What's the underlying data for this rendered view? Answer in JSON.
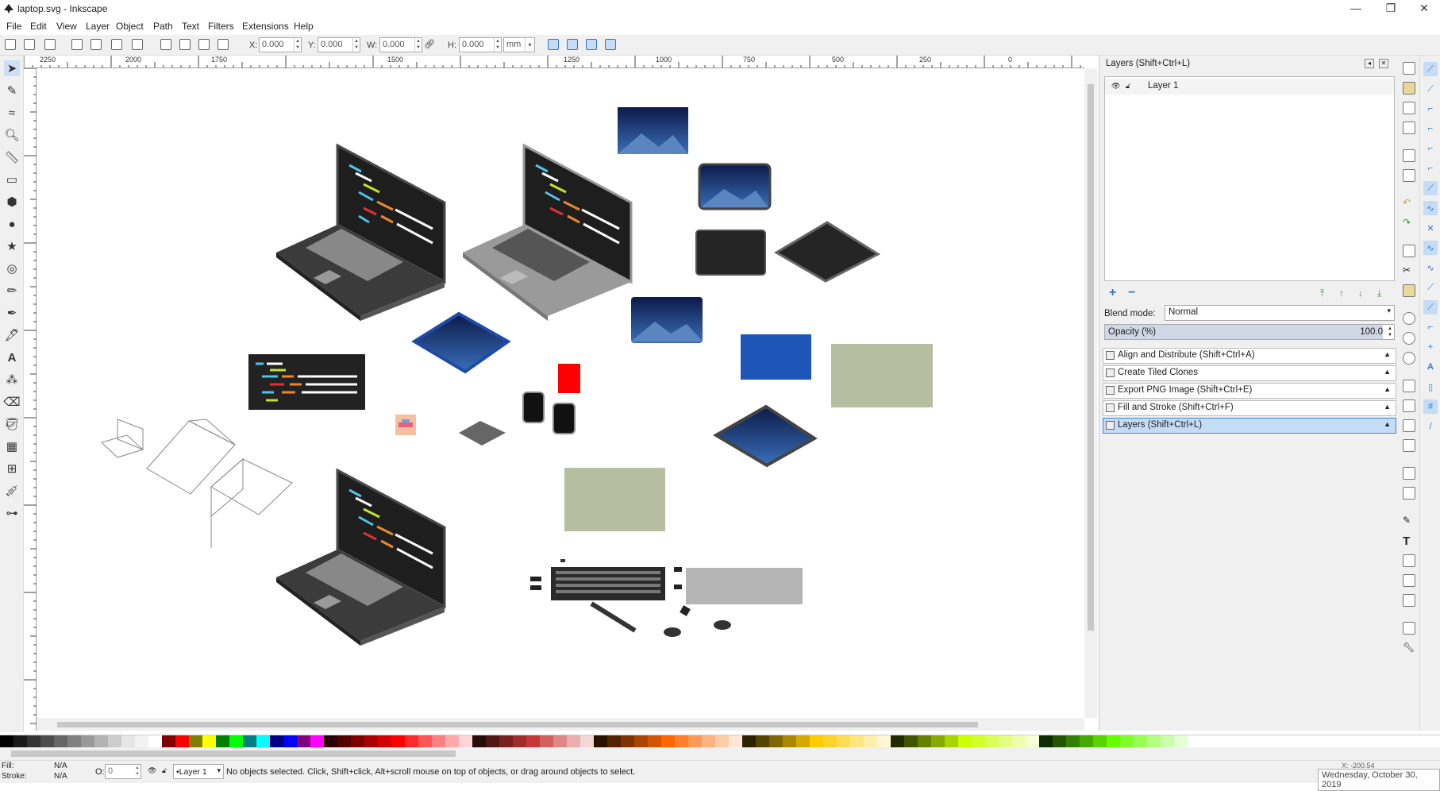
{
  "window": {
    "title": "laptop.svg - Inkscape",
    "minimize": "—",
    "maximize": "❐",
    "close": "✕"
  },
  "menu": [
    "File",
    "Edit",
    "View",
    "Layer",
    "Object",
    "Path",
    "Text",
    "Filters",
    "Extensions",
    "Help"
  ],
  "toolbar": {
    "x_label": "X:",
    "x_value": "0.000",
    "y_label": "Y:",
    "y_value": "0.000",
    "w_label": "W:",
    "w_value": "0.000",
    "h_label": "H:",
    "h_value": "0.000",
    "unit": "mm"
  },
  "ruler": {
    "h_ticks": [
      "2250",
      "2000",
      "1750",
      "1500",
      "1250",
      "1000",
      "750",
      "500",
      "250",
      "0"
    ]
  },
  "panel": {
    "layers_title": "Layers (Shift+Ctrl+L)",
    "layer_name": "Layer 1",
    "blend_label": "Blend mode:",
    "blend_value": "Normal",
    "opacity_label": "Opacity (%)",
    "opacity_value": "100.0",
    "opacity_level": 1.0,
    "docks": [
      "Align and Distribute (Shift+Ctrl+A)",
      "Create Tiled Clones",
      "Export PNG Image (Shift+Ctrl+E)",
      "Fill and Stroke (Shift+Ctrl+F)",
      "Layers (Shift+Ctrl+L)"
    ]
  },
  "status": {
    "fill_label": "Fill:",
    "fill_value": "N/A",
    "stroke_label": "Stroke:",
    "stroke_value": "N/A",
    "opacity_label": "O:",
    "opacity_value": "0",
    "layer": "•Layer 1",
    "message": "No objects selected. Click, Shift+click, Alt+scroll mouse on top of objects, or drag around objects to select.",
    "date": "Wednesday, October 30, 2019",
    "coords": "X: -200.54"
  },
  "colors": {
    "accent": "#3378c4",
    "screen_dark": "#222222",
    "sage": "#b7bda0",
    "blue_rect": "#1e56b8",
    "red_rect": "#ff0000"
  }
}
